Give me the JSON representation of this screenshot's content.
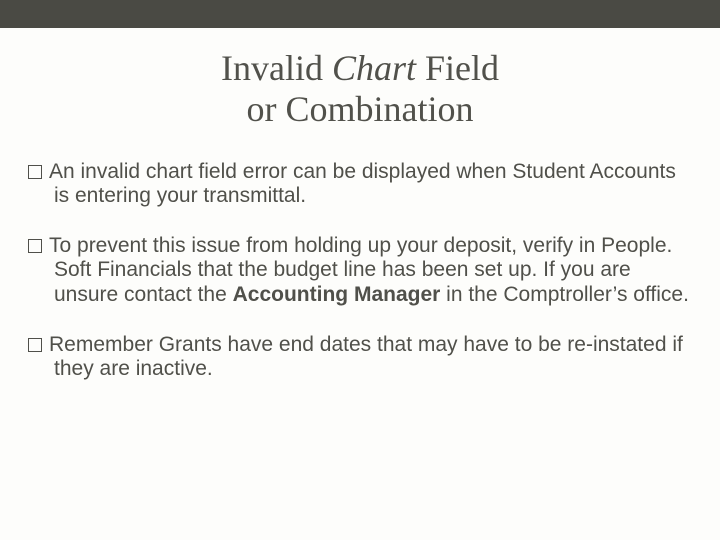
{
  "title": {
    "pre": "Invalid ",
    "italic": "Chart ",
    "post1": "Field",
    "line2": "or Combination"
  },
  "bullets": {
    "b1": "An invalid chart field error can be displayed when Student Accounts is entering your transmittal.",
    "b2a": "To prevent this issue from holding up your deposit, verify in People. Soft Financials that the budget line has been set up.  If you are unsure contact the ",
    "b2bold": "Accounting Manager",
    "b2b": " in the Comptroller’s office.",
    "b3": "Remember Grants have end dates that may have to be re-instated if they are inactive."
  }
}
